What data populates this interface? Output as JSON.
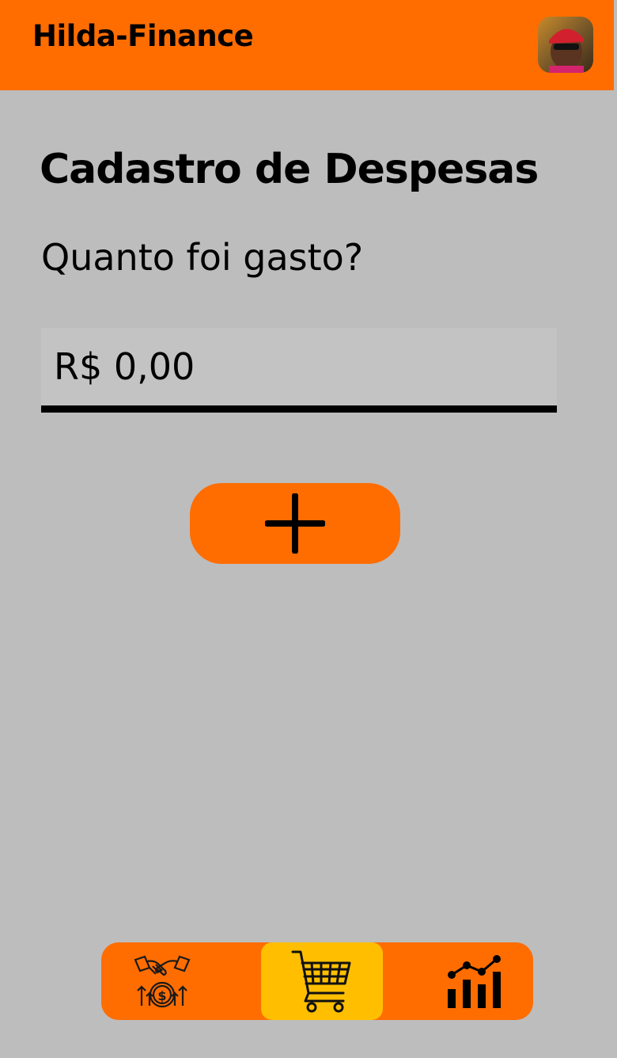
{
  "app": {
    "title": "Hilda-Finance",
    "accent_color": "#ff6d00",
    "active_tab_color": "#ffbf00"
  },
  "header": {
    "avatar_icon": "user-avatar-photo"
  },
  "form": {
    "title": "Cadastro de Despesas",
    "question": "Quanto foi gasto?",
    "amount_value": "R$ 0,00",
    "add_icon": "plus-icon"
  },
  "nav": {
    "items": [
      {
        "icon": "income-handshake-money-icon",
        "active": false
      },
      {
        "icon": "shopping-cart-icon",
        "active": true
      },
      {
        "icon": "bar-chart-trend-icon",
        "active": false
      }
    ]
  }
}
